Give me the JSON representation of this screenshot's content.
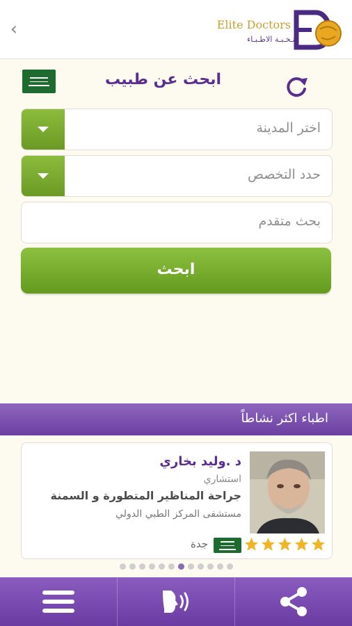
{
  "header": {
    "back_icon": "chevron-left-icon",
    "brand_en": "Elite Doctors",
    "brand_ar": "نـخـبـة الاطـبـاء"
  },
  "search": {
    "title": "ابحث عن طبيب",
    "city_placeholder": "اختر المدينة",
    "specialty_placeholder": "حدد التخصص",
    "advanced_placeholder": "بحث متقدم",
    "button_label": "ابحث",
    "accent_green": "#7aab2e",
    "accent_purple": "#5b2d8e"
  },
  "section": {
    "title": "اطباء اكثر نشاطاً"
  },
  "doctor": {
    "name": "د .وليد بخاري",
    "title": "استشاري",
    "specialty": "جراحة المناظير المتطورة و السمنة",
    "hospital": "مستشفى المركز الطبي الدولي",
    "city": "جدة",
    "rating": 5,
    "star_color": "#f0b428"
  },
  "pagination": {
    "count": 12,
    "active_index": 6
  },
  "bottom_nav": [
    {
      "icon": "menu-icon"
    },
    {
      "icon": "voice-search-icon"
    },
    {
      "icon": "share-icon"
    }
  ]
}
